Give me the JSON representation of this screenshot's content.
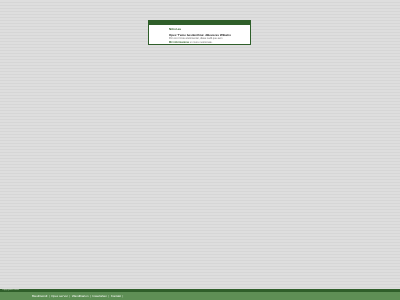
{
  "dialog": {
    "title": "Nitrol.eu",
    "heading": "Opex T'eme besilenthiur. dBevezes Wibatro",
    "body": "Pon sro il zute arulomentar, diase nedil que aem",
    "link_label": "Mir informazione",
    "link_suffix": " un more nesitomate."
  },
  "footer": {
    "top_text": "Copyrighted Footer",
    "links": [
      "Biesihteindl",
      "Opex ser'ver",
      "Wandlbarion",
      "Inwerlahen",
      "Kontakt"
    ],
    "separator": "|"
  }
}
